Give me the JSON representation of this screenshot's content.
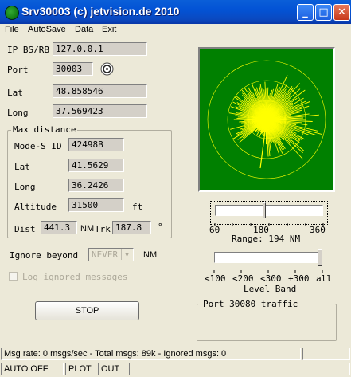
{
  "window": {
    "title": "Srv30003 (c) jetvision.de 2010",
    "controls": {
      "minimize": "_",
      "maximize": "□",
      "close": "✕"
    }
  },
  "menu": [
    {
      "label": "File",
      "mnemonic": "F",
      "rest": "ile"
    },
    {
      "label": "AutoSave",
      "mnemonic": "A",
      "rest": "utoSave"
    },
    {
      "label": "Data",
      "mnemonic": "D",
      "rest": "ata"
    },
    {
      "label": "Exit",
      "mnemonic": "E",
      "rest": "xit"
    }
  ],
  "connection": {
    "ip_label": "IP BS/RB",
    "ip_value": "127.0.0.1",
    "port_label": "Port",
    "port_value": "30003",
    "lat_label": "Lat",
    "lat_value": "48.858546",
    "long_label": "Long",
    "long_value": "37.569423"
  },
  "max_distance": {
    "title": "Max distance",
    "modes_label": "Mode-S ID",
    "modes_value": "42498B",
    "lat_label": "Lat",
    "lat_value": "41.5629",
    "long_label": "Long",
    "long_value": "36.2426",
    "alt_label": "Altitude",
    "alt_value": "31500",
    "alt_unit": "ft",
    "dist_label": "Dist",
    "dist_value": "441.3",
    "dist_unit": "NM",
    "trk_label": "Trk",
    "trk_value": "187.8",
    "trk_unit": "°"
  },
  "ignore": {
    "label": "Ignore beyond",
    "select_value": "NEVER",
    "unit": "NM",
    "log_checkbox_label": "Log ignored messages",
    "log_checked": false
  },
  "stop_button": "STOP",
  "range": {
    "ticks": [
      "60",
      "180",
      "360"
    ],
    "label": "Range: 194 NM",
    "slider_value_nm": 194
  },
  "level_band": {
    "ticks": [
      "<100",
      "<200",
      "<300",
      "+300",
      "all"
    ],
    "label": "Level Band"
  },
  "port_traffic": {
    "title": "Port 30080 traffic"
  },
  "status": {
    "message": "Msg rate: 0 msgs/sec - Total msgs: 89k - Ignored msgs: 0",
    "auto": "AUTO OFF",
    "plot": "PLOT",
    "out": "OUT"
  },
  "colors": {
    "radar_bg": "#008000",
    "radar_trace": "#ffff00",
    "titlebar": "#0a5fd8"
  }
}
